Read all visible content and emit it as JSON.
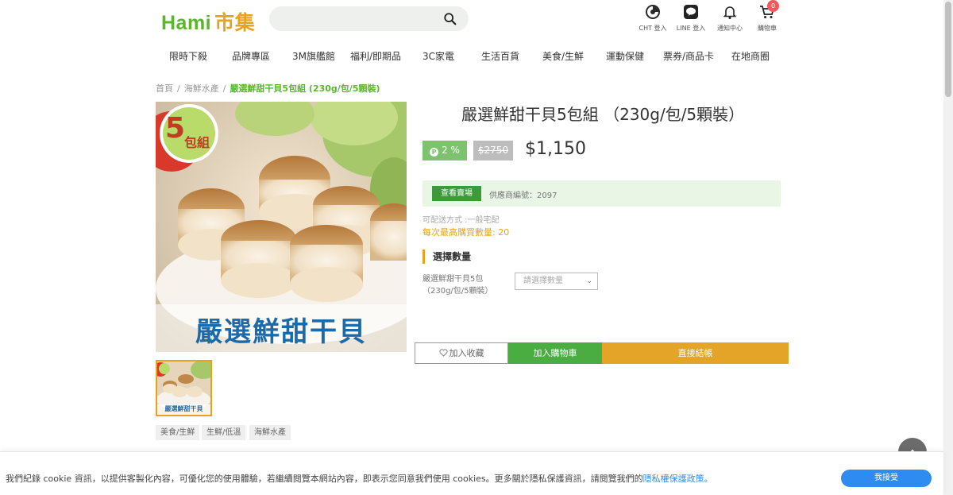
{
  "header": {
    "logo_hami": "Hami",
    "logo_shiji": "市集",
    "search_placeholder": "",
    "icons": [
      {
        "name": "cht-login",
        "label": "CHT 登入"
      },
      {
        "name": "line-login",
        "label": "LINE 登入"
      },
      {
        "name": "notification",
        "label": "通知中心"
      },
      {
        "name": "cart",
        "label": "購物車",
        "badge": "0"
      }
    ]
  },
  "nav": {
    "items": [
      "限時下殺",
      "品牌專區",
      "3M旗艦館",
      "福利/即期品",
      "3C家電",
      "生活百貨",
      "美食/生鮮",
      "運動保健",
      "票券/商品卡",
      "在地商圈"
    ]
  },
  "breadcrumb": {
    "items": [
      "首頁",
      "海鮮水產"
    ],
    "current": "嚴選鮮甜干貝5包組 (230g/包/5顆裝)"
  },
  "product": {
    "image_badge_num": "5",
    "image_badge_text": "包組",
    "image_caption": "嚴選鮮甜干貝",
    "title": "嚴選鮮甜干貝5包組 （230g/包/5顆裝）",
    "reward": "2 %",
    "reward_coin": "P",
    "original_price": "$2750",
    "price": "$1,150",
    "vendor_button": "查看賣場",
    "vendor_no": "供應商編號：2097",
    "shipping": "可配送方式 :一般宅配",
    "max_buy": "每次最高購買數量: 20",
    "qty_heading": "選擇數量",
    "qty_label_line1": "嚴選鮮甜干貝5包",
    "qty_label_line2": "（230g/包/5顆裝）",
    "qty_select": "請選擇數量",
    "tags": [
      "美食/生鮮",
      "生鮮/低溫",
      "海鮮水產"
    ]
  },
  "actions": {
    "favorite": "加入收藏",
    "add_to_cart": "加入購物車",
    "buy_now": "直接結帳"
  },
  "cookie": {
    "text": "我們紀錄 cookie 資訊，以提供客製化內容，可優化您的使用體驗，若繼續閱覽本網站內容，即表示您同意我們使用 cookies。更多關於隱私保護資訊，請閱覽我們的",
    "link": "隱私權保護政策",
    "suffix": "。",
    "accept": "我接受"
  },
  "colors": {
    "brand_green": "#5cb531",
    "brand_orange": "#e8a31c",
    "cart_green": "#49ad42",
    "buy_orange": "#e3a427",
    "link_blue": "#2e8cf0"
  }
}
